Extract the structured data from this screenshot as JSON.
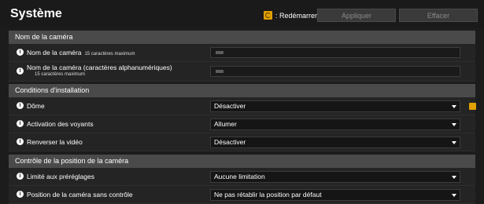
{
  "header": {
    "title": "Système",
    "restart_label": ": Redémarrer",
    "apply_label": "Appliquer",
    "clear_label": "Effacer"
  },
  "sections": {
    "camera_name": {
      "title": "Nom de la caméra",
      "rows": {
        "name": {
          "label": "Nom de la caméra",
          "hint": "15 caractères maximum"
        },
        "name_alnum": {
          "label": "Nom de la caméra (caractères alphanumériques)",
          "hint": "15 caractères maximum"
        }
      }
    },
    "install": {
      "title": "Conditions d'installation",
      "rows": {
        "dome": {
          "label": "Dôme",
          "value": "Désactiver"
        },
        "leds": {
          "label": "Activation des voyants",
          "value": "Allumer"
        },
        "flip": {
          "label": "Renverser la vidéo",
          "value": "Désactiver"
        }
      }
    },
    "position": {
      "title": "Contrôle de la position de la caméra",
      "rows": {
        "presets": {
          "label": "Limité aux préréglages",
          "value": "Aucune limitation"
        },
        "idle": {
          "label": "Position de la caméra sans contrôle",
          "value": "Ne pas rétablir la position par défaut"
        }
      }
    }
  },
  "icons": {
    "info": "info-icon",
    "restart": "restart-icon",
    "caret": "chevron-down-icon"
  },
  "colors": {
    "background": "#1c1c1c",
    "section_header": "#4a4a4a",
    "restart_accent": "#e0a000"
  }
}
